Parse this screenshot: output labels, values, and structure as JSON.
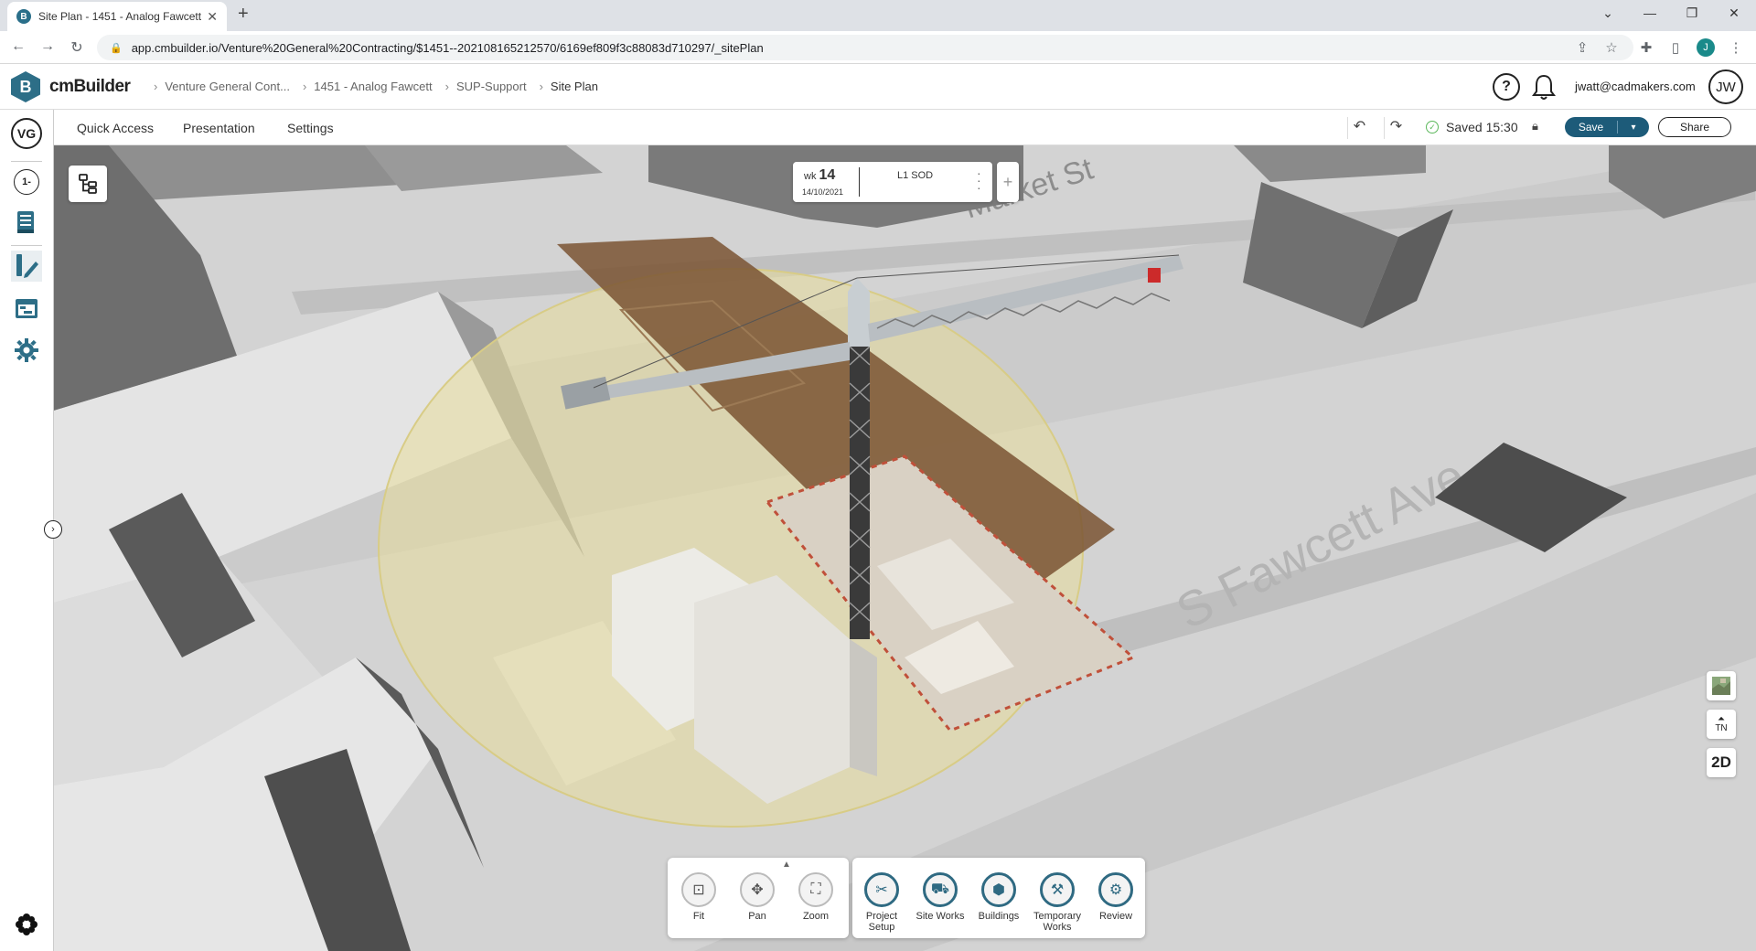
{
  "browser": {
    "tab_title": "Site Plan - 1451 - Analog Fawcett",
    "url": "app.cmbuilder.io/Venture%20General%20Contracting/$1451--20210816521257​0/6169ef809f3c88083d710297/_sitePlan",
    "profile_initial": "J"
  },
  "app": {
    "logo_letter": "B",
    "logo_text": "cmBuilder",
    "breadcrumb": [
      "Venture General Cont...",
      "1451 - Analog Fawcett",
      "SUP-Support",
      "Site Plan"
    ],
    "help_label": "?",
    "user_email": "jwatt@cadmakers.com",
    "user_initials": "JW"
  },
  "left_rail": {
    "org_initials": "VG",
    "version_label": "1-"
  },
  "toolbar": {
    "tabs": [
      "Quick Access",
      "Presentation",
      "Settings"
    ],
    "saved_text": "Saved 15:30",
    "save_label": "Save",
    "share_label": "Share"
  },
  "timeline": {
    "wk_label": "wk",
    "week": "14",
    "date": "14/10/2021",
    "phase": "L1 SOD",
    "add_label": "+"
  },
  "view_tools": [
    {
      "label": "Fit",
      "icon": "fit-icon"
    },
    {
      "label": "Pan",
      "icon": "pan-icon"
    },
    {
      "label": "Zoom",
      "icon": "zoom-icon"
    }
  ],
  "category_tools": [
    {
      "label_line1": "Project",
      "label_line2": "Setup",
      "icon": "project-setup-icon"
    },
    {
      "label_line1": "Site Works",
      "label_line2": "",
      "icon": "site-works-icon"
    },
    {
      "label_line1": "Buildings",
      "label_line2": "",
      "icon": "buildings-icon"
    },
    {
      "label_line1": "Temporary",
      "label_line2": "Works",
      "icon": "temporary-works-icon"
    },
    {
      "label_line1": "Review",
      "label_line2": "",
      "icon": "review-icon"
    }
  ],
  "view_controls": {
    "north_label": "TN",
    "mode_label": "2D"
  },
  "map_labels": {
    "street_1": "S Fawcett Ave",
    "street_2": "Market St"
  },
  "colors": {
    "brand": "#2d6e87",
    "save_button": "#1d5b79",
    "saved_check": "#5cb85c",
    "crane_radius": "#e8dc9a",
    "excavation": "#7a5432"
  }
}
